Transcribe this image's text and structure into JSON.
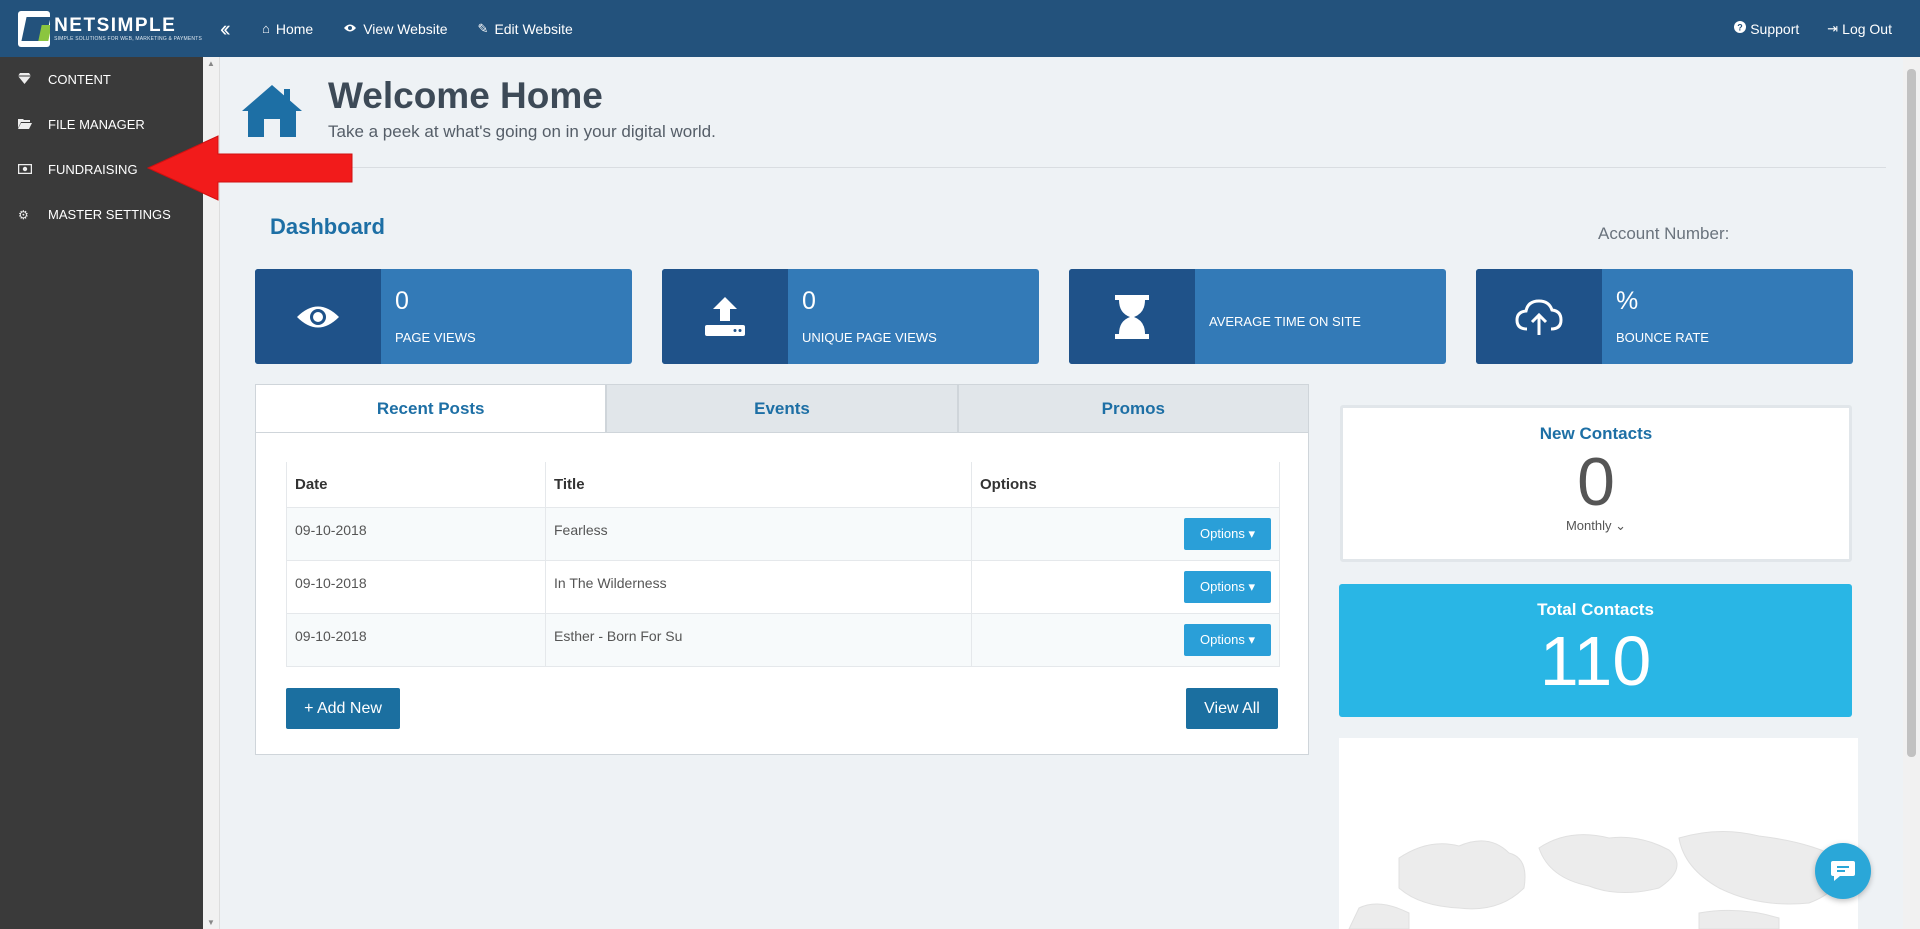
{
  "brand": {
    "name": "NETSIMPLE",
    "tagline": "SIMPLE SOLUTIONS FOR WEB, MARKETING & PAYMENTS",
    "color_primary": "#23527c",
    "color_accent": "#8bc53f"
  },
  "topnav": {
    "collapse_icon": "double-chevron-left-icon",
    "home": "Home",
    "view_website": "View Website",
    "edit_website": "Edit Website",
    "support": "Support",
    "logout": "Log Out"
  },
  "sidebar": {
    "items": [
      {
        "label": "CONTENT",
        "icon": "diamond-icon"
      },
      {
        "label": "FILE MANAGER",
        "icon": "folder-open-icon"
      },
      {
        "label": "FUNDRAISING",
        "icon": "money-icon"
      },
      {
        "label": "MASTER SETTINGS",
        "icon": "gear-icon"
      }
    ]
  },
  "header": {
    "title": "Welcome Home",
    "subtitle": "Take a peek at what's going on in your digital world."
  },
  "dashboard": {
    "title": "Dashboard",
    "account_label": "Account Number:"
  },
  "stats": [
    {
      "value": "0",
      "label": "PAGE VIEWS",
      "icon": "eye-icon"
    },
    {
      "value": "0",
      "label": "UNIQUE PAGE VIEWS",
      "icon": "upload-icon"
    },
    {
      "value": "",
      "label": "AVERAGE TIME ON SITE",
      "icon": "hourglass-icon"
    },
    {
      "value": "%",
      "label": "BOUNCE RATE",
      "icon": "cloud-upload-icon"
    }
  ],
  "tabs": {
    "items": [
      "Recent Posts",
      "Events",
      "Promos"
    ],
    "active": "Recent Posts"
  },
  "posts_table": {
    "headers": [
      "Date",
      "Title",
      "Options"
    ],
    "rows": [
      {
        "date": "09-10-2018",
        "title": "Fearless",
        "option": "Options"
      },
      {
        "date": "09-10-2018",
        "title": "In The Wilderness",
        "option": "Options"
      },
      {
        "date": "09-10-2018",
        "title": "Esther - Born For Su",
        "option": "Options"
      }
    ],
    "add_new": "+ Add New",
    "view_all": "View All"
  },
  "new_contacts": {
    "title": "New Contacts",
    "value": "0",
    "period": "Monthly"
  },
  "total_contacts": {
    "title": "Total Contacts",
    "value": "110"
  },
  "colors": {
    "stat_bg": "#337ab7",
    "stat_icon_bg": "#1f5289",
    "total_contacts_bg": "#29b6e5",
    "annotation_arrow": "#f21b1b"
  }
}
